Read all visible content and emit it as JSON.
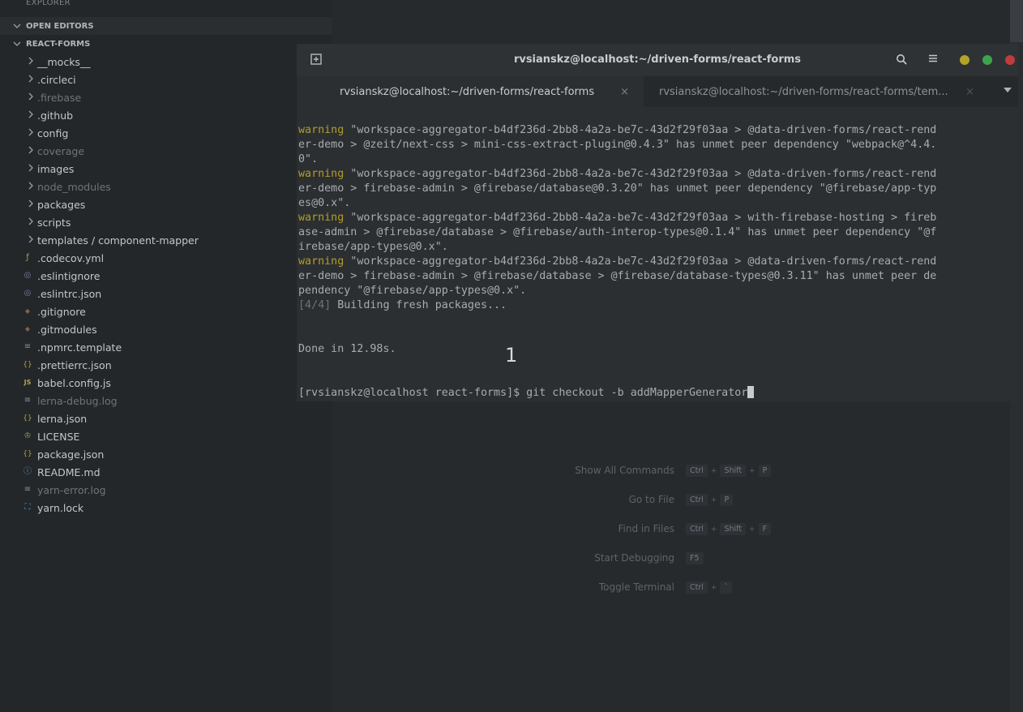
{
  "sidebar": {
    "title": "EXPLORER",
    "open_editors": "OPEN EDITORS",
    "project": "REACT-FORMS",
    "items": [
      {
        "label": "__mocks__",
        "icon": "chevron-right-icon"
      },
      {
        "label": ".circleci",
        "icon": "chevron-right-icon"
      },
      {
        "label": ".firebase",
        "icon": "chevron-right-icon"
      },
      {
        "label": ".github",
        "icon": "chevron-right-icon"
      },
      {
        "label": "config",
        "icon": "chevron-right-icon"
      },
      {
        "label": "coverage",
        "icon": "chevron-right-icon"
      },
      {
        "label": "images",
        "icon": "chevron-right-icon"
      },
      {
        "label": "node_modules",
        "icon": "chevron-right-icon"
      },
      {
        "label": "packages",
        "icon": "chevron-right-icon"
      },
      {
        "label": "scripts",
        "icon": "chevron-right-icon"
      },
      {
        "label": "templates / component-mapper",
        "icon": "chevron-right-icon"
      },
      {
        "label": ".codecov.yml",
        "icon": "yaml-file-icon"
      },
      {
        "label": ".eslintignore",
        "icon": "eslint-icon"
      },
      {
        "label": ".eslintrc.json",
        "icon": "eslint-icon"
      },
      {
        "label": ".gitignore",
        "icon": "git-icon"
      },
      {
        "label": ".gitmodules",
        "icon": "git-icon"
      },
      {
        "label": ".npmrc.template",
        "icon": "lines-file-icon"
      },
      {
        "label": ".prettierrc.json",
        "icon": "json-file-icon"
      },
      {
        "label": "babel.config.js",
        "icon": "js-file-icon"
      },
      {
        "label": "lerna-debug.log",
        "icon": "lines-file-icon"
      },
      {
        "label": "lerna.json",
        "icon": "json-file-icon"
      },
      {
        "label": "LICENSE",
        "icon": "license-icon"
      },
      {
        "label": "package.json",
        "icon": "json-file-icon"
      },
      {
        "label": "README.md",
        "icon": "info-icon"
      },
      {
        "label": "yarn-error.log",
        "icon": "lines-file-icon"
      },
      {
        "label": "yarn.lock",
        "icon": "yarn-icon"
      }
    ]
  },
  "terminal": {
    "title": "rvsianskz@localhost:~/driven-forms/react-forms",
    "tabs": [
      {
        "label": "rvsianskz@localhost:~/driven-forms/react-forms",
        "close": "×"
      },
      {
        "label": "rvsianskz@localhost:~/driven-forms/react-forms/tem...",
        "close": "×"
      }
    ],
    "lines": [
      {
        "kind": "warn",
        "prefix": "warning",
        "text": " \"workspace-aggregator-b4df236d-2bb8-4a2a-be7c-43d2f29f03aa > @data-driven-forms/react-rend"
      },
      {
        "kind": "plain",
        "text": "er-demo > @zeit/next-css > mini-css-extract-plugin@0.4.3\" has unmet peer dependency \"webpack@^4.4."
      },
      {
        "kind": "plain",
        "text": "0\"."
      },
      {
        "kind": "warn",
        "prefix": "warning",
        "text": " \"workspace-aggregator-b4df236d-2bb8-4a2a-be7c-43d2f29f03aa > @data-driven-forms/react-rend"
      },
      {
        "kind": "plain",
        "text": "er-demo > firebase-admin > @firebase/database@0.3.20\" has unmet peer dependency \"@firebase/app-typ"
      },
      {
        "kind": "plain",
        "text": "es@0.x\"."
      },
      {
        "kind": "warn",
        "prefix": "warning",
        "text": " \"workspace-aggregator-b4df236d-2bb8-4a2a-be7c-43d2f29f03aa > with-firebase-hosting > fireb"
      },
      {
        "kind": "plain",
        "text": "ase-admin > @firebase/database > @firebase/auth-interop-types@0.1.4\" has unmet peer dependency \"@f"
      },
      {
        "kind": "plain",
        "text": "irebase/app-types@0.x\"."
      },
      {
        "kind": "warn",
        "prefix": "warning",
        "text": " \"workspace-aggregator-b4df236d-2bb8-4a2a-be7c-43d2f29f03aa > @data-driven-forms/react-rend"
      },
      {
        "kind": "plain",
        "text": "er-demo > firebase-admin > @firebase/database > @firebase/database-types@0.3.11\" has unmet peer de"
      },
      {
        "kind": "plain",
        "text": "pendency \"@firebase/app-types@0.x\"."
      },
      {
        "kind": "step",
        "prefix": "[4/4]",
        "text": " Building fresh packages..."
      },
      {
        "kind": "plain",
        "text": ""
      },
      {
        "kind": "plain",
        "text": ""
      },
      {
        "kind": "plain",
        "text": "Done in 12.98s."
      },
      {
        "kind": "plain",
        "text": ""
      },
      {
        "kind": "plain",
        "text": ""
      },
      {
        "kind": "prompt",
        "text": "[rvsianskz@localhost react-forms]$ git checkout -b addMapperGenerator"
      }
    ]
  },
  "step_badge": "1",
  "shortcuts": [
    {
      "name": "Show All Commands",
      "keys": [
        "Ctrl",
        "Shift",
        "P"
      ]
    },
    {
      "name": "Go to File",
      "keys": [
        "Ctrl",
        "P"
      ]
    },
    {
      "name": "Find in Files",
      "keys": [
        "Ctrl",
        "Shift",
        "F"
      ]
    },
    {
      "name": "Start Debugging",
      "keys": [
        "F5"
      ]
    },
    {
      "name": "Toggle Terminal",
      "keys": [
        "Ctrl",
        "`"
      ]
    }
  ],
  "window_controls": {
    "minimize": "#b3a32a",
    "maximize": "#3fa34d",
    "close": "#c03c3c"
  }
}
